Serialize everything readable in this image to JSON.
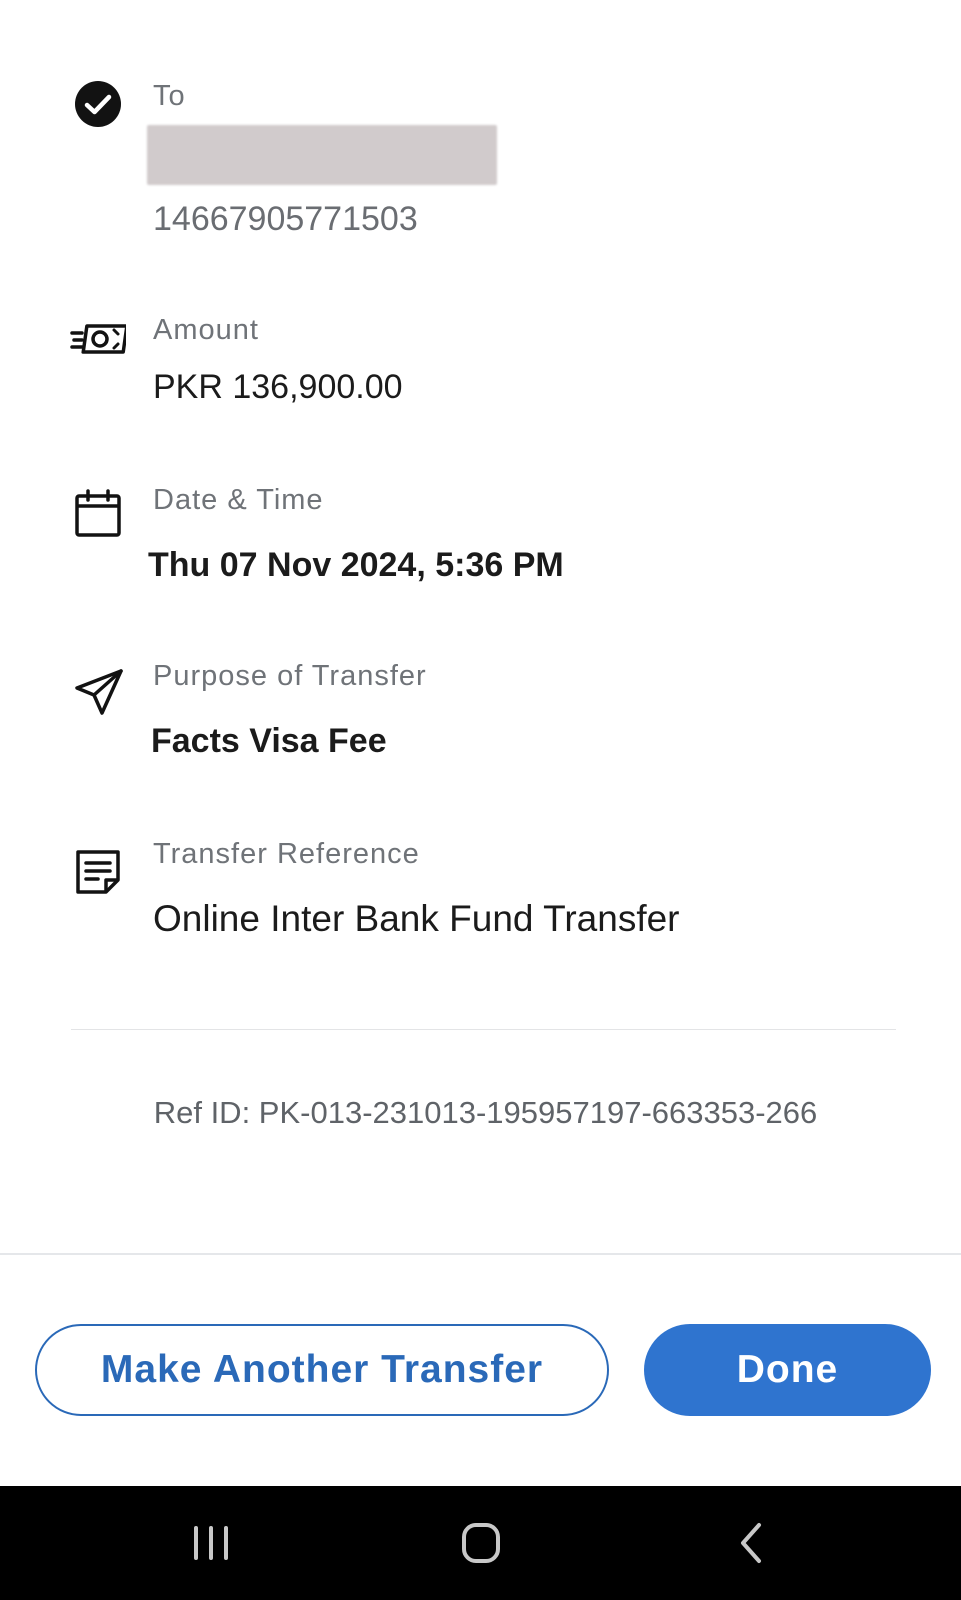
{
  "recipient": {
    "label": "To",
    "account_number": "14667905771503"
  },
  "amount": {
    "label": "Amount",
    "value": "PKR 136,900.00"
  },
  "datetime": {
    "label": "Date & Time",
    "value": "Thu 07 Nov 2024, 5:36 PM"
  },
  "purpose": {
    "label": "Purpose of Transfer",
    "value": "Facts Visa Fee"
  },
  "reference": {
    "label": "Transfer Reference",
    "value": "Online Inter Bank Fund Transfer"
  },
  "ref_id": "Ref ID: PK-013-231013-195957197-663353-266",
  "actions": {
    "make_another": "Make Another Transfer",
    "done": "Done"
  },
  "icons": {
    "recipient": "check-circle-icon",
    "amount": "cash-icon",
    "datetime": "calendar-icon",
    "purpose": "send-icon",
    "reference": "note-icon"
  },
  "colors": {
    "accent": "#2f74cf",
    "accent_outline": "#2a69b8"
  }
}
